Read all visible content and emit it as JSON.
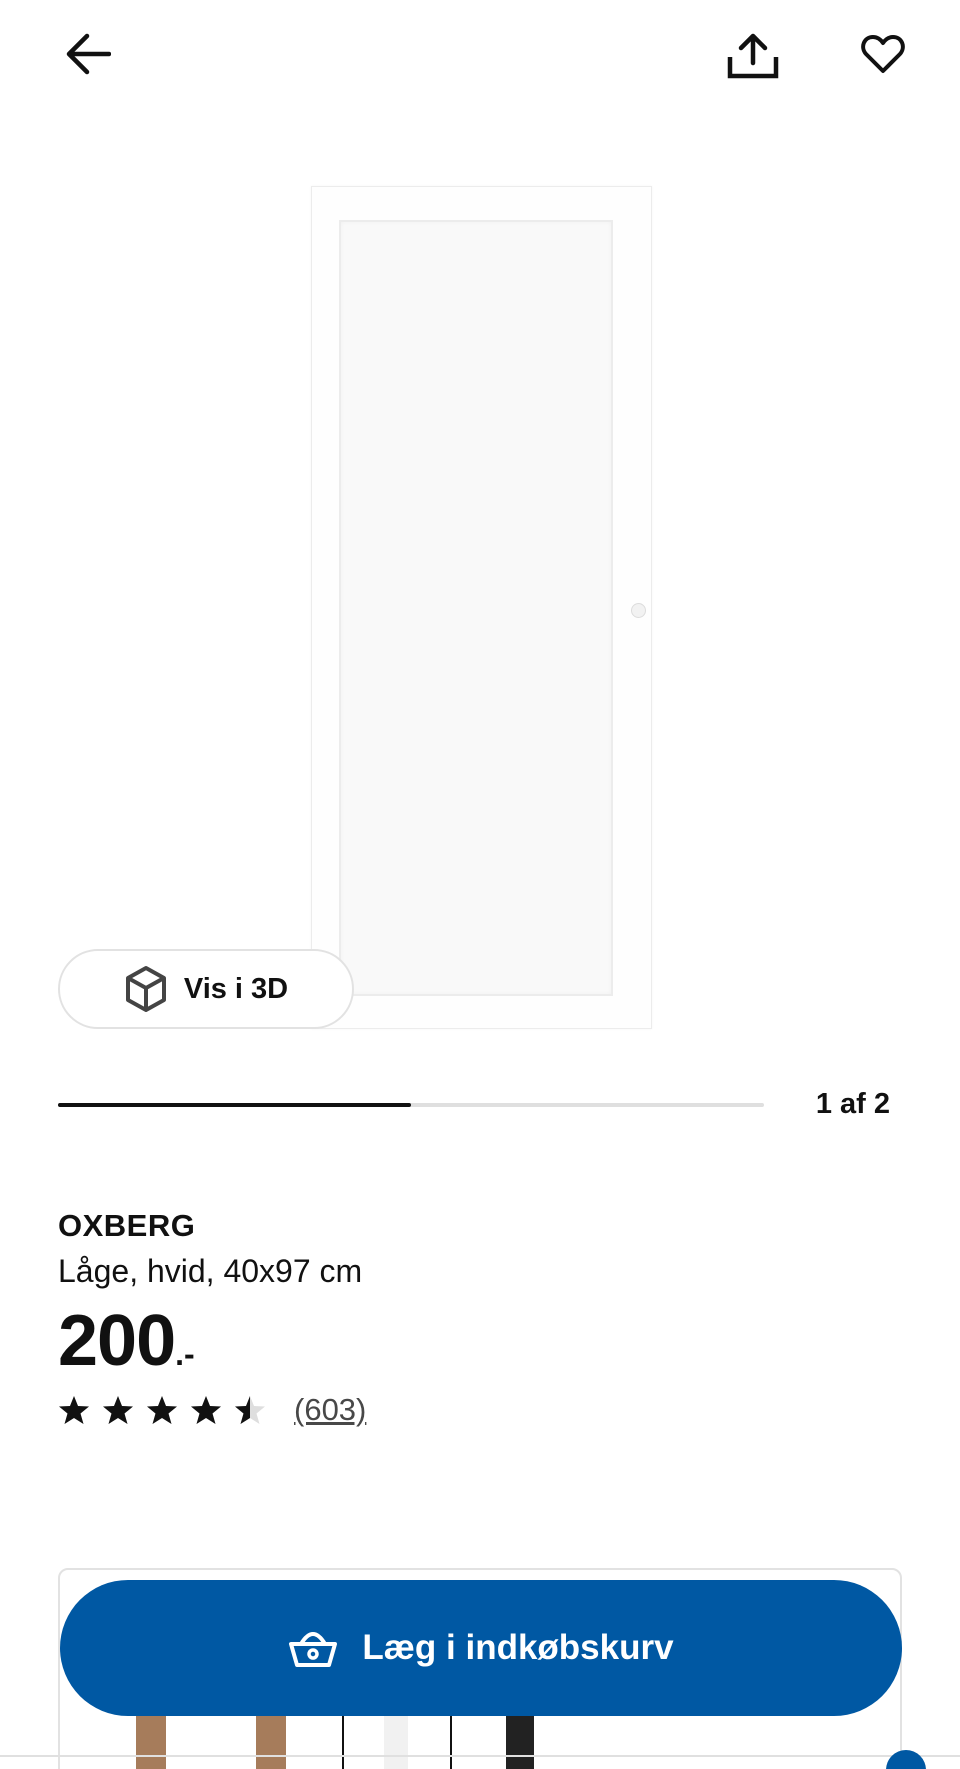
{
  "top_bar": {
    "back_icon": "arrow-left-icon",
    "share_icon": "share-icon",
    "favorite_icon": "heart-icon"
  },
  "gallery": {
    "view_3d_label": "Vis i 3D",
    "view_3d_icon": "cube-icon",
    "progress_label": "1 af 2",
    "progress_fraction": 0.5
  },
  "product": {
    "name": "OXBERG",
    "description": "Låge, hvid, 40x97 cm",
    "price_integer": "200",
    "price_suffix": ".-",
    "rating_value": 4.5,
    "rating_max": 5,
    "review_count": "(603)"
  },
  "actions": {
    "add_to_cart_label": "Læg i indkøbskurv",
    "add_to_cart_icon": "basket-icon"
  },
  "colors": {
    "brand_blue": "#0058a3",
    "text": "#111111",
    "track": "#dfdfdf"
  }
}
